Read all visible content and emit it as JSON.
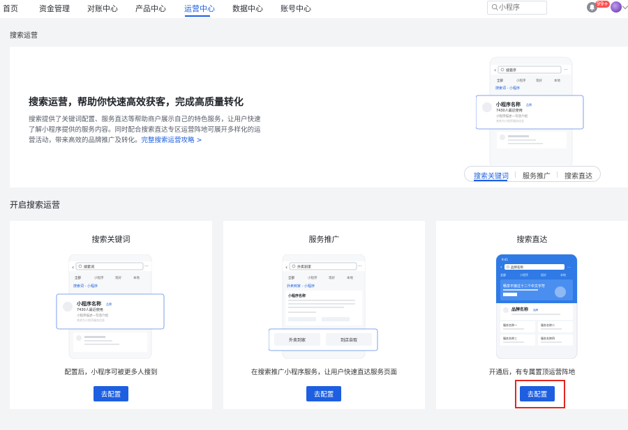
{
  "nav": {
    "items": [
      "首页",
      "资金管理",
      "对账中心",
      "产品中心",
      "运营中心",
      "数据中心",
      "账号中心"
    ],
    "active": "运营中心",
    "search_placeholder": "小程序",
    "badge": "99+"
  },
  "breadcrumb": "搜索运营",
  "hero": {
    "title": "搜索运营，帮助你快速高效获客，完成高质量转化",
    "description": "搜索提供了关键词配置、服务直达等帮助商户展示自己的特色服务，让用户快速了解小程序提供的服务内容。同时配合搜索直达专区运营阵地可展开多样化的运营活动，带来高效的品牌推广及转化。",
    "link": "完整搜索运营攻略 >",
    "tabs": [
      "搜索关键词",
      "服务推广",
      "搜索直达"
    ],
    "active_tab": "搜索关键词",
    "mockup": {
      "search_text": "搜索序",
      "filters": [
        "全部",
        "小程序",
        "现好",
        "本地"
      ],
      "section": "搜索词 - 小程序",
      "card_name": "小程序名称",
      "card_tag": "品牌",
      "card_users": "7430人最近使用",
      "card_desc": "小程序描述一句话介绍",
      "card_desc2": "其他为小程序服务信息"
    }
  },
  "section_title": "开启搜索运营",
  "cards": [
    {
      "title": "搜索关键词",
      "description": "配置后，小程序可被更多人搜到",
      "button": "去配置",
      "mockup": {
        "search_text": "搜索词",
        "filters": [
          "全部",
          "小程序",
          "现好",
          "本地"
        ],
        "section": "搜索词 - 小程序",
        "card_name": "小程序名称",
        "card_tag": "品牌",
        "card_users": "7430人最近使用",
        "card_desc": "小程序描述一句话介绍",
        "card_desc2": "其他为小程序服务信息"
      }
    },
    {
      "title": "服务推广",
      "description": "在搜索推广小程序服务，让用户快速直达服务页面",
      "button": "去配置",
      "mockup": {
        "search_text": "外卖到家",
        "filters": [
          "全部",
          "小程序",
          "现好",
          "本地"
        ],
        "section": "外卖到家 - 小程序",
        "card_name": "小程序名称",
        "chips": [
          "外卖到家",
          "到店自取"
        ]
      }
    },
    {
      "title": "搜索直达",
      "description": "开通后，有专属置顶运营阵地",
      "button": "去配置",
      "mockup": {
        "search_text": "品牌名称",
        "filters": [
          "全部",
          "小程序",
          "现好",
          "本地"
        ],
        "banner": "畅享不接过十二个中文字符",
        "brand_name": "品牌名称",
        "tag": "品牌",
        "services": [
          "服务名称一",
          "服务名称二",
          "服务名称三",
          "服务名称四"
        ]
      }
    }
  ],
  "colors": {
    "primary": "#1d5fe0",
    "highlight": "#e0251f",
    "background": "#f3f4f6"
  }
}
